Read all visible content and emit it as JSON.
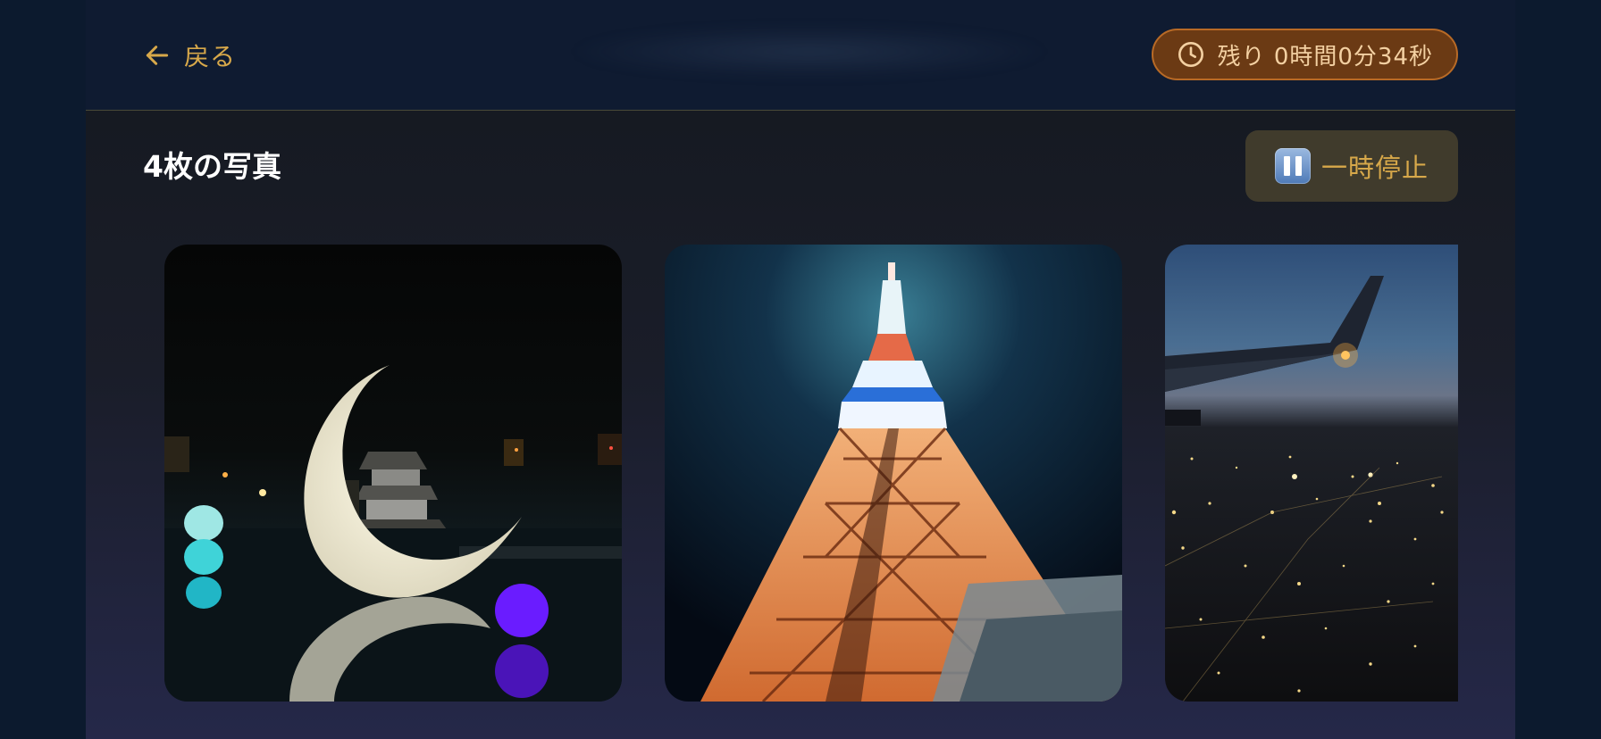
{
  "header": {
    "back_label": "戻る",
    "timer_label": "残り 0時間0分34秒"
  },
  "gallery": {
    "count_label": "4枚の写真",
    "pause_label": "一時停止",
    "photos": [
      {
        "subject": "crescent-moon-castle-night"
      },
      {
        "subject": "tokyo-tower-night"
      },
      {
        "subject": "airplane-wing-city-lights"
      }
    ]
  },
  "colors": {
    "accent": "#d7a84a",
    "timer_bg": "#6b3a14",
    "timer_border": "#b86a26",
    "pause_bg": "#403b2c"
  }
}
